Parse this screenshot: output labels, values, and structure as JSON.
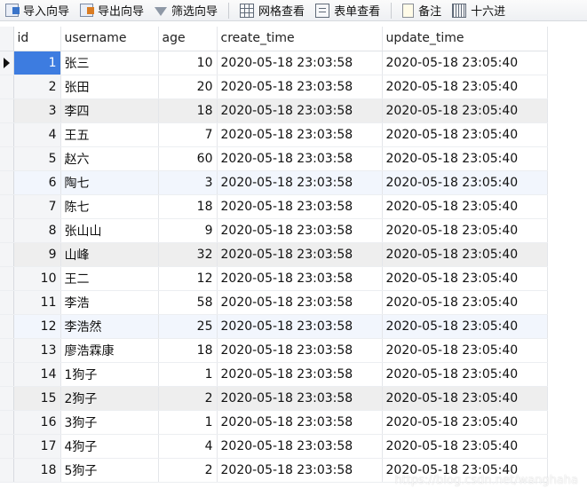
{
  "toolbar": {
    "import": "导入向导",
    "export": "导出向导",
    "filter": "筛选向导",
    "grid_view": "网格查看",
    "form_view": "表单查看",
    "note": "备注",
    "hex": "十六进"
  },
  "table": {
    "columns": [
      "id",
      "username",
      "age",
      "create_time",
      "update_time"
    ],
    "rows": [
      {
        "id": "1",
        "username": "张三",
        "age": "10",
        "create_time": "2020-05-18 23:03:58",
        "update_time": "2020-05-18 23:05:40"
      },
      {
        "id": "2",
        "username": "张田",
        "age": "20",
        "create_time": "2020-05-18 23:03:58",
        "update_time": "2020-05-18 23:05:40"
      },
      {
        "id": "3",
        "username": "李四",
        "age": "18",
        "create_time": "2020-05-18 23:03:58",
        "update_time": "2020-05-18 23:05:40"
      },
      {
        "id": "4",
        "username": "王五",
        "age": "7",
        "create_time": "2020-05-18 23:03:58",
        "update_time": "2020-05-18 23:05:40"
      },
      {
        "id": "5",
        "username": "赵六",
        "age": "60",
        "create_time": "2020-05-18 23:03:58",
        "update_time": "2020-05-18 23:05:40"
      },
      {
        "id": "6",
        "username": "陶七",
        "age": "3",
        "create_time": "2020-05-18 23:03:58",
        "update_time": "2020-05-18 23:05:40"
      },
      {
        "id": "7",
        "username": "陈七",
        "age": "18",
        "create_time": "2020-05-18 23:03:58",
        "update_time": "2020-05-18 23:05:40"
      },
      {
        "id": "8",
        "username": "张山山",
        "age": "9",
        "create_time": "2020-05-18 23:03:58",
        "update_time": "2020-05-18 23:05:40"
      },
      {
        "id": "9",
        "username": "山峰",
        "age": "32",
        "create_time": "2020-05-18 23:03:58",
        "update_time": "2020-05-18 23:05:40"
      },
      {
        "id": "10",
        "username": "王二",
        "age": "12",
        "create_time": "2020-05-18 23:03:58",
        "update_time": "2020-05-18 23:05:40"
      },
      {
        "id": "11",
        "username": "李浩",
        "age": "58",
        "create_time": "2020-05-18 23:03:58",
        "update_time": "2020-05-18 23:05:40"
      },
      {
        "id": "12",
        "username": "李浩然",
        "age": "25",
        "create_time": "2020-05-18 23:03:58",
        "update_time": "2020-05-18 23:05:40"
      },
      {
        "id": "13",
        "username": "廖浩霖康",
        "age": "18",
        "create_time": "2020-05-18 23:03:58",
        "update_time": "2020-05-18 23:05:40"
      },
      {
        "id": "14",
        "username": "1狗子",
        "age": "1",
        "create_time": "2020-05-18 23:03:58",
        "update_time": "2020-05-18 23:05:40"
      },
      {
        "id": "15",
        "username": "2狗子",
        "age": "2",
        "create_time": "2020-05-18 23:03:58",
        "update_time": "2020-05-18 23:05:40"
      },
      {
        "id": "16",
        "username": "3狗子",
        "age": "1",
        "create_time": "2020-05-18 23:03:58",
        "update_time": "2020-05-18 23:05:40"
      },
      {
        "id": "17",
        "username": "4狗子",
        "age": "4",
        "create_time": "2020-05-18 23:03:58",
        "update_time": "2020-05-18 23:05:40"
      },
      {
        "id": "18",
        "username": "5狗子",
        "age": "2",
        "create_time": "2020-05-18 23:03:58",
        "update_time": "2020-05-18 23:05:40"
      }
    ]
  },
  "watermark": "https://blog.csdn.net/wanghaha"
}
